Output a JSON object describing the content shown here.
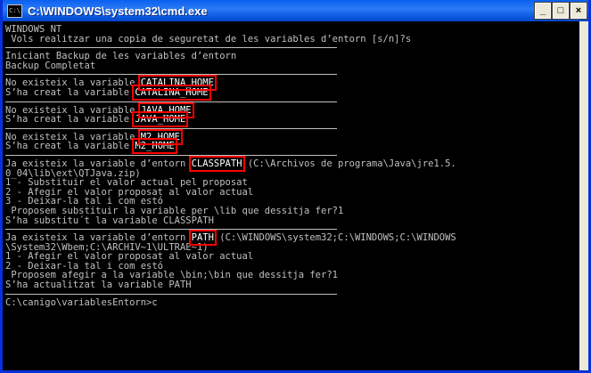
{
  "window": {
    "title": "C:\\WINDOWS\\system32\\cmd.exe",
    "icon_text": "C:\\",
    "controls": {
      "minimize": "_",
      "maximize": "□",
      "close": "×"
    }
  },
  "console": {
    "block1": [
      "WINDOWS NT",
      " Vols realitzar una copia de seguretat de les variables d’entorn [s/n]?s"
    ],
    "block2": [
      "Iniciant Backup de les variables d’entorn",
      "Backup Completat"
    ],
    "catalina": {
      "l1_pre": "No existeix la variable ",
      "l1_var": "CATALINA_HOME",
      "l2_pre": "S’ha creat la variable ",
      "l2_var": "CATALINA_HOME"
    },
    "java": {
      "l1_pre": "No existeix la variable ",
      "l1_var": "JAVA_HOME",
      "l2_pre": "S’ha creat la variable ",
      "l2_var": "JAVA_HOME"
    },
    "m2": {
      "l1_pre": "No existeix la variable ",
      "l1_var": "M2_HOME",
      "l2_pre": "S’ha creat la variable ",
      "l2_var": "M2_HOME"
    },
    "classpath": {
      "l1_pre": "Ja existeix la variable d’entorn ",
      "l1_var": "CLASSPATH",
      "l1_post": " (C:\\Archivos de programa\\Java\\jre1.5.",
      "lines": [
        "0_04\\lib\\ext\\QTJava.zip)",
        "1 - Substituir el valor actual pel proposat",
        "2 - Afegir el valor proposat al valor actual",
        "3 - Deixar-la tal i com estó",
        " Proposem substituir la variable per \\lib que dessitja fer?1",
        "S’ha substitu´t la variable CLASSPATH"
      ]
    },
    "path": {
      "l1_pre": "Ja existeix la variable d’entorn ",
      "l1_var": "PATH",
      "l1_post": " (C:\\WINDOWS\\system32;C:\\WINDOWS;C:\\WINDOWS",
      "lines": [
        "\\System32\\Wbem;C:\\ARCHIV~1\\ULTRAE~1)",
        "1 - Afegir el valor proposat al valor actual",
        "2 - Deixar-la tal i com estó",
        " Proposem afegir a la variable \\bin;\\bin que dessitja fer?1",
        "S’ha actualitzat la variable PATH"
      ]
    },
    "prompt": "C:\\canigo\\variablesEntorn>c"
  }
}
